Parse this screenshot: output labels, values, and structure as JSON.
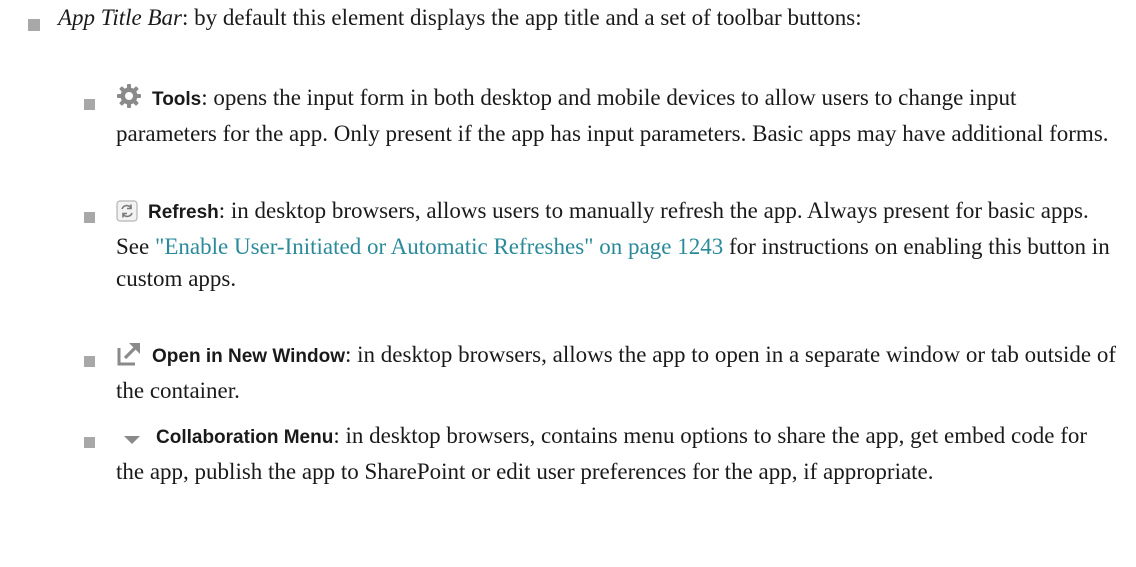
{
  "intro": {
    "term": "App Title Bar",
    "text": ": by default this element displays the app title and a set of toolbar buttons:"
  },
  "items": [
    {
      "icon": "gear-icon",
      "label": "Tools",
      "text": ": opens the input form in both desktop and mobile devices to allow users to change input parameters for the app. Only present if the app has input parameters. Basic apps may have additional forms."
    },
    {
      "icon": "refresh-icon",
      "label": "Refresh",
      "text": ": in desktop browsers, allows users to manually refresh the app. Always present for basic apps. See ",
      "link": "\"Enable User-Initiated or Automatic Refreshes\" on page 1243",
      "text_after": " for instructions on enabling this button in custom apps."
    },
    {
      "icon": "open-new-window-icon",
      "label": "Open in New Window",
      "text": ": in desktop browsers, allows the app to open in a separate window or tab outside of the container."
    },
    {
      "icon": "chevron-down-icon",
      "label": "Collaboration Menu",
      "text": ": in desktop browsers, contains menu options to share the app, get embed code for the app, publish the app to SharePoint or edit user preferences for the app, if appropriate."
    }
  ],
  "colors": {
    "bullet": "#a8a8a8",
    "link": "#2a8a9a",
    "text": "#1a1a1a"
  }
}
